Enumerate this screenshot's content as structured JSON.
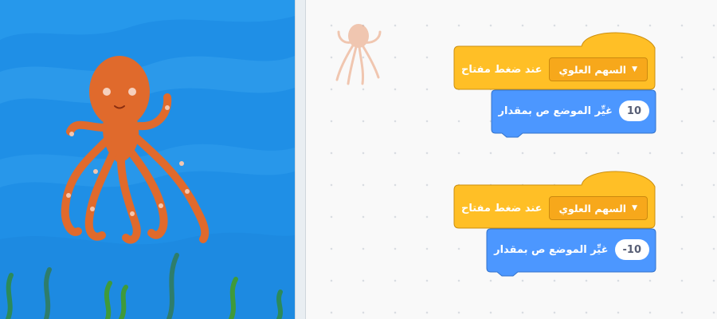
{
  "scripts": [
    {
      "hat": {
        "label": "عند ضغط مفتاح",
        "key": "السهم العلوي"
      },
      "motion": {
        "label": "غيِّر الموضع ص بمقدار",
        "value": "10"
      }
    },
    {
      "hat": {
        "label": "عند ضغط مفتاح",
        "key": "السهم العلوي"
      },
      "motion": {
        "label": "غيِّر الموضع ص بمقدار",
        "value": "-10"
      }
    }
  ],
  "colors": {
    "events": "#ffbf26",
    "events_dark": "#cc8f0f",
    "motion": "#4c97ff",
    "motion_dark": "#3373cc",
    "stage_water": "#1e8fe6",
    "sprite": "#e86a30"
  },
  "icons": {
    "dropdown_caret": "caret-down-icon",
    "sprite": "octopus-sprite"
  }
}
